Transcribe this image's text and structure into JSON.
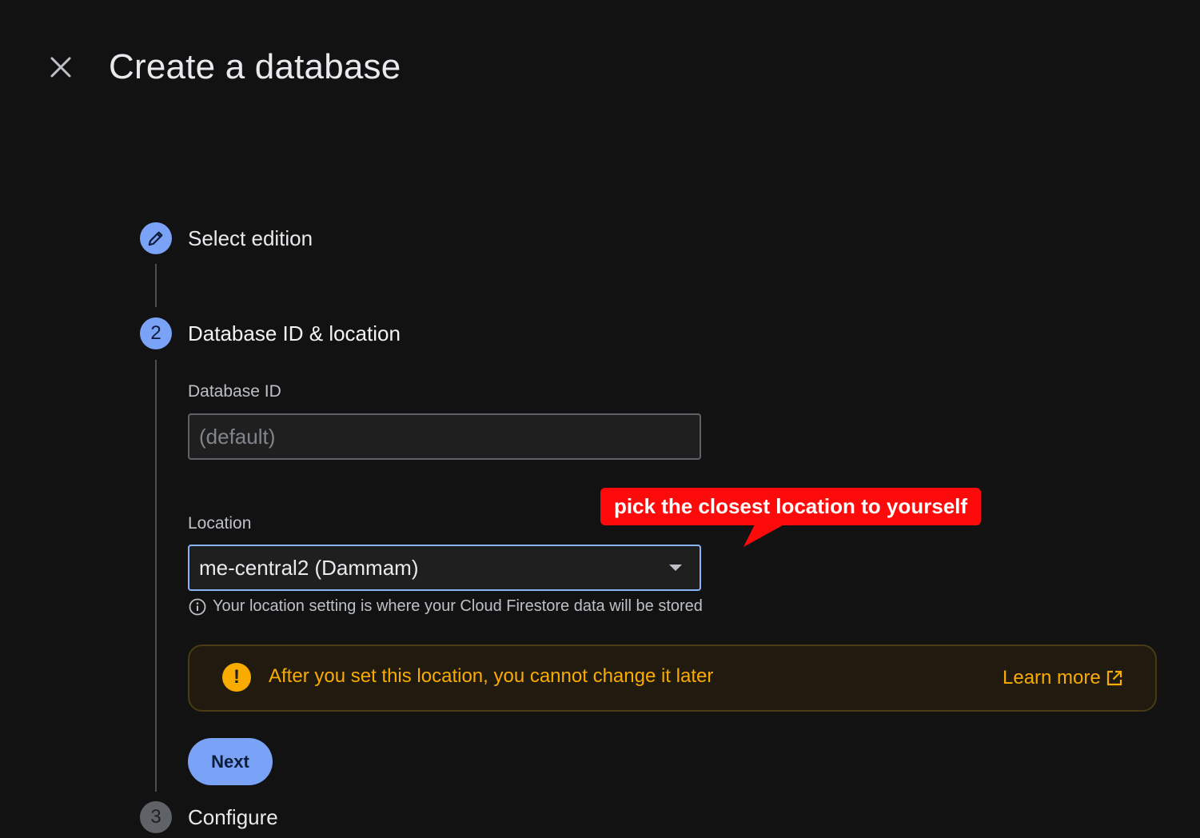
{
  "header": {
    "title": "Create a database",
    "close_icon": "close-icon"
  },
  "steps": [
    {
      "indicator": "",
      "icon": "pencil-icon",
      "label": "Select edition",
      "state": "completed"
    },
    {
      "indicator": "2",
      "label": "Database ID & location",
      "state": "current"
    },
    {
      "indicator": "3",
      "label": "Configure",
      "state": "pending"
    }
  ],
  "form": {
    "database_id": {
      "label": "Database ID",
      "placeholder": "(default)",
      "value": ""
    },
    "location": {
      "label": "Location",
      "value": "me-central2 (Dammam)",
      "hint": "Your location setting is where your Cloud Firestore data will be stored"
    }
  },
  "warning": {
    "text": "After you set this location, you cannot change it later",
    "link_label": "Learn more",
    "link_icon": "external-link-icon"
  },
  "actions": {
    "next_label": "Next"
  },
  "annotation": {
    "callout_text": "pick the closest location to yourself"
  },
  "colors": {
    "background": "#121212",
    "accent_blue": "#7aa3f7",
    "warning_amber": "#f9ab00",
    "callout_red": "#ff0a0a"
  }
}
